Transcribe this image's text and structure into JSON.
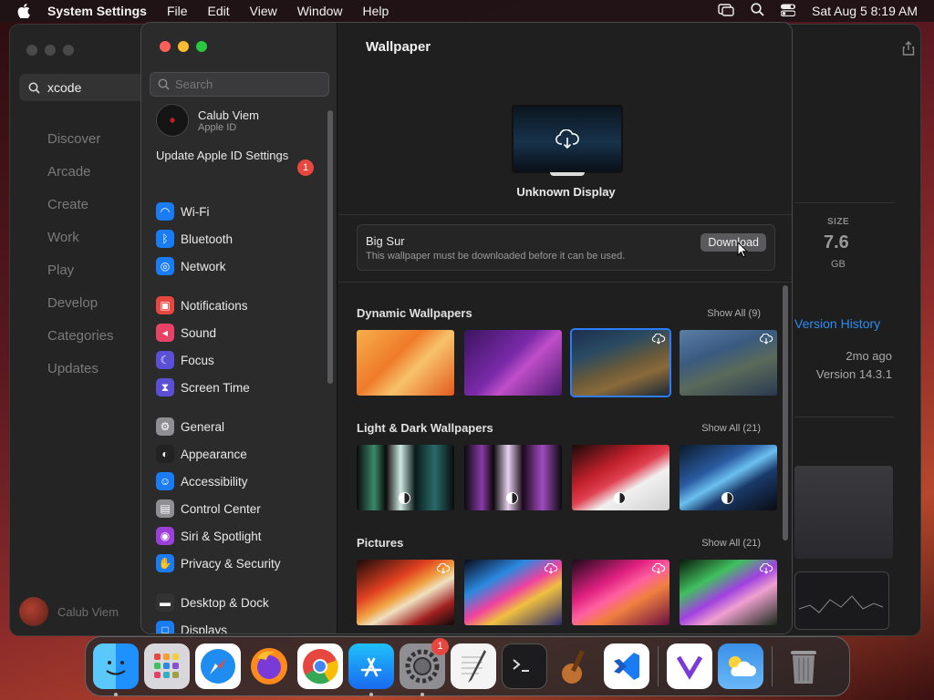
{
  "menubar": {
    "app_name": "System Settings",
    "menus": [
      "File",
      "Edit",
      "View",
      "Window",
      "Help"
    ],
    "clock": "Sat Aug 5  8:19 AM"
  },
  "appstore": {
    "search_value": "xcode",
    "nav": [
      "Discover",
      "Arcade",
      "Create",
      "Work",
      "Play",
      "Develop",
      "Categories",
      "Updates"
    ],
    "user_name": "Calub Viem",
    "size_label": "SIZE",
    "size_value": "7.6",
    "size_unit": "GB",
    "version_history": "Version History",
    "ago": "2mo ago",
    "version": "Version 14.3.1"
  },
  "settings": {
    "search_placeholder": "Search",
    "profile": {
      "name": "Calub Viem",
      "sub": "Apple ID"
    },
    "update": {
      "label": "Update Apple ID Settings",
      "badge": "1"
    },
    "groups": [
      [
        {
          "label": "Wi-Fi",
          "icon": "wifi-icon",
          "color": "#1a7cf5"
        },
        {
          "label": "Bluetooth",
          "icon": "bluetooth-icon",
          "color": "#1a7cf5"
        },
        {
          "label": "Network",
          "icon": "globe-icon",
          "color": "#1a7cf5"
        }
      ],
      [
        {
          "label": "Notifications",
          "icon": "bell-icon",
          "color": "#e8473f"
        },
        {
          "label": "Sound",
          "icon": "speaker-icon",
          "color": "#e84366"
        },
        {
          "label": "Focus",
          "icon": "moon-icon",
          "color": "#5b4fd6"
        },
        {
          "label": "Screen Time",
          "icon": "hourglass-icon",
          "color": "#5b4fd6"
        }
      ],
      [
        {
          "label": "General",
          "icon": "gear-icon",
          "color": "#8e8e93"
        },
        {
          "label": "Appearance",
          "icon": "appearance-icon",
          "color": "#222222"
        },
        {
          "label": "Accessibility",
          "icon": "accessibility-icon",
          "color": "#1a7cf5"
        },
        {
          "label": "Control Center",
          "icon": "control-center-icon",
          "color": "#8e8e93"
        },
        {
          "label": "Siri & Spotlight",
          "icon": "siri-icon",
          "color": "#9b3fd8"
        },
        {
          "label": "Privacy & Security",
          "icon": "hand-icon",
          "color": "#1a7cf5"
        }
      ],
      [
        {
          "label": "Desktop & Dock",
          "icon": "dock-icon",
          "color": "#333333"
        },
        {
          "label": "Displays",
          "icon": "display-icon",
          "color": "#1a7cf5"
        }
      ]
    ],
    "main": {
      "title": "Wallpaper",
      "display_name": "Unknown Display",
      "wallpaper_name": "Big Sur",
      "wallpaper_desc": "This wallpaper must be downloaded before it can be used.",
      "download_label": "Download",
      "sections": [
        {
          "title": "Dynamic Wallpapers",
          "show_all": "Show All (9)"
        },
        {
          "title": "Light & Dark Wallpapers",
          "show_all": "Show All (21)"
        },
        {
          "title": "Pictures",
          "show_all": "Show All (21)"
        }
      ]
    }
  },
  "dock": {
    "apps": [
      "finder-icon",
      "launchpad-icon",
      "safari-icon",
      "firefox-icon",
      "chrome-icon",
      "app-store-icon",
      "system-settings-icon",
      "textedit-icon",
      "terminal-icon",
      "instruments-icon",
      "vscode-icon",
      "visual-studio-icon",
      "weather-icon",
      "trash-icon"
    ],
    "settings_badge": "1"
  }
}
